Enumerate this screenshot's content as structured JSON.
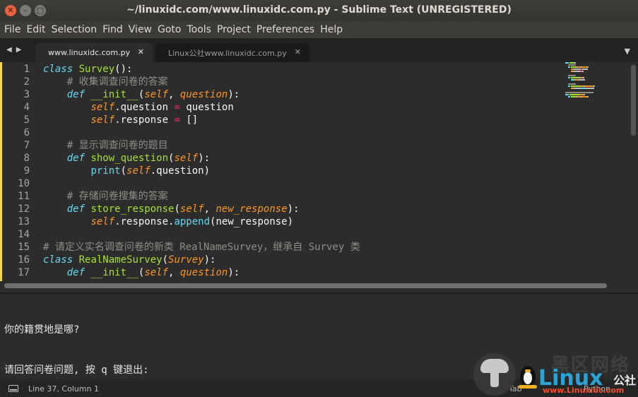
{
  "window": {
    "title": "~/linuxidc.com/www.linuxidc.com.py - Sublime Text (UNREGISTERED)"
  },
  "menu": [
    "File",
    "Edit",
    "Selection",
    "Find",
    "View",
    "Goto",
    "Tools",
    "Project",
    "Preferences",
    "Help"
  ],
  "tabs": [
    {
      "label": "www.linuxidc.com.py",
      "active": true
    },
    {
      "label": "Linux公社www.linuxidc.com.py",
      "active": false
    }
  ],
  "editor": {
    "line_numbers": [
      "1",
      "2",
      "3",
      "4",
      "5",
      "6",
      "7",
      "8",
      "9",
      "10",
      "11",
      "12",
      "13",
      "14",
      "15",
      "16",
      "17"
    ],
    "lines": [
      [
        {
          "t": "class",
          "c": "kw"
        },
        {
          "t": " "
        },
        {
          "t": "Survey",
          "c": "cls"
        },
        {
          "t": "():"
        }
      ],
      [
        {
          "t": "    "
        },
        {
          "t": "# 收集调查问卷的答案",
          "c": "cmt"
        }
      ],
      [
        {
          "t": "    "
        },
        {
          "t": "def",
          "c": "kw"
        },
        {
          "t": " "
        },
        {
          "t": "__init__",
          "c": "fn"
        },
        {
          "t": "("
        },
        {
          "t": "self",
          "c": "self"
        },
        {
          "t": ", "
        },
        {
          "t": "question",
          "c": "param"
        },
        {
          "t": "):"
        }
      ],
      [
        {
          "t": "        "
        },
        {
          "t": "self",
          "c": "self"
        },
        {
          "t": ".question "
        },
        {
          "t": "=",
          "c": "op"
        },
        {
          "t": " question"
        }
      ],
      [
        {
          "t": "        "
        },
        {
          "t": "self",
          "c": "self"
        },
        {
          "t": ".response "
        },
        {
          "t": "=",
          "c": "op"
        },
        {
          "t": " []"
        }
      ],
      [
        {
          "t": ""
        }
      ],
      [
        {
          "t": "    "
        },
        {
          "t": "# 显示调查问卷的题目",
          "c": "cmt"
        }
      ],
      [
        {
          "t": "    "
        },
        {
          "t": "def",
          "c": "kw"
        },
        {
          "t": " "
        },
        {
          "t": "show_question",
          "c": "fn"
        },
        {
          "t": "("
        },
        {
          "t": "self",
          "c": "self"
        },
        {
          "t": "):"
        }
      ],
      [
        {
          "t": "        "
        },
        {
          "t": "print",
          "c": "builtin"
        },
        {
          "t": "("
        },
        {
          "t": "self",
          "c": "self"
        },
        {
          "t": ".question)"
        }
      ],
      [
        {
          "t": ""
        }
      ],
      [
        {
          "t": "    "
        },
        {
          "t": "# 存储问卷搜集的答案",
          "c": "cmt"
        }
      ],
      [
        {
          "t": "    "
        },
        {
          "t": "def",
          "c": "kw"
        },
        {
          "t": " "
        },
        {
          "t": "store_response",
          "c": "fn"
        },
        {
          "t": "("
        },
        {
          "t": "self",
          "c": "self"
        },
        {
          "t": ", "
        },
        {
          "t": "new_response",
          "c": "param"
        },
        {
          "t": "):"
        }
      ],
      [
        {
          "t": "        "
        },
        {
          "t": "self",
          "c": "self"
        },
        {
          "t": ".response."
        },
        {
          "t": "append",
          "c": "builtin"
        },
        {
          "t": "(new_response)"
        }
      ],
      [
        {
          "t": ""
        }
      ],
      [
        {
          "t": "# 请定义实名调查问卷的新类 RealNameSurvey，继承自 Survey 类",
          "c": "cmt"
        }
      ],
      [
        {
          "t": "class",
          "c": "kw"
        },
        {
          "t": " "
        },
        {
          "t": "RealNameSurvey",
          "c": "cls"
        },
        {
          "t": "("
        },
        {
          "t": "Survey",
          "c": "self"
        },
        {
          "t": "):"
        }
      ],
      [
        {
          "t": "    "
        },
        {
          "t": "def",
          "c": "kw"
        },
        {
          "t": " "
        },
        {
          "t": "__init__",
          "c": "fn"
        },
        {
          "t": "("
        },
        {
          "t": "self",
          "c": "self"
        },
        {
          "t": ", "
        },
        {
          "t": "question",
          "c": "param"
        },
        {
          "t": "):"
        }
      ]
    ]
  },
  "console": {
    "lines": [
      "你的籍贯地是哪?",
      "请回答问卷问题, 按 q 键退出:"
    ]
  },
  "status": {
    "position": "Line 37, Column 1",
    "tab_size": "Tab",
    "syntax": "Python"
  },
  "watermark": {
    "cn": "黑区网络",
    "brand": "Linux",
    "brand_cn": "公社",
    "url": "www.Linuxidc.com"
  },
  "colors": {
    "accent_modified": "#f2d64b",
    "close_button": "#e8623d",
    "brand_blue": "#2aa3d6",
    "brand_red": "#f04f2e"
  },
  "icons": {
    "close": "close-icon",
    "minimize": "minimize-icon",
    "maximize": "maximize-icon",
    "nav_back": "arrow-left-icon",
    "nav_forward": "arrow-right-icon",
    "tab_dropdown": "chevron-down-icon",
    "panel": "panel-toggle-icon"
  }
}
